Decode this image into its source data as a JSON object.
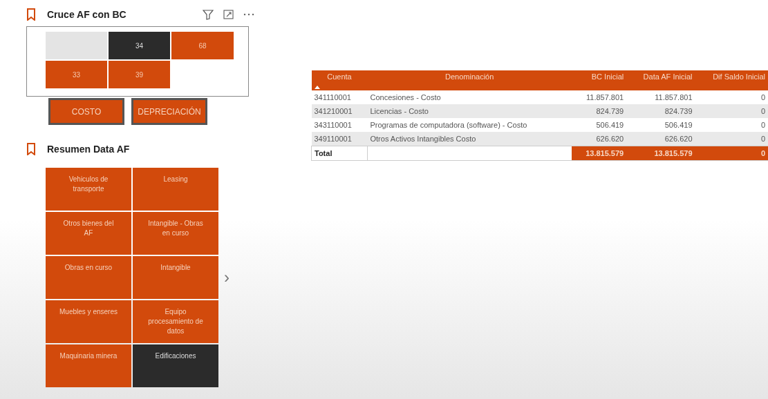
{
  "cruce": {
    "title": "Cruce AF con BC",
    "tiles": [
      {
        "kind": "blank",
        "selected": false
      },
      {
        "kind": "value",
        "label": "34",
        "selected": true
      },
      {
        "kind": "value",
        "label": "68",
        "selected": false
      },
      {
        "kind": "value",
        "label": "33",
        "selected": false
      },
      {
        "kind": "value",
        "label": "39",
        "selected": false
      }
    ],
    "buttons": [
      "COSTO",
      "DEPRECIACIÓN"
    ]
  },
  "resumen": {
    "title": "Resumen Data AF",
    "tiles": [
      {
        "label": "Vehiculos de transporte",
        "selected": false
      },
      {
        "label": "Leasing",
        "selected": false
      },
      {
        "label": "Otros bienes del AF",
        "selected": false
      },
      {
        "label": "Intangible - Obras en curso",
        "selected": false
      },
      {
        "label": "Obras en curso",
        "selected": false
      },
      {
        "label": "Intangible",
        "selected": false
      },
      {
        "label": "Muebles y enseres",
        "selected": false
      },
      {
        "label": "Equipo procesamiento de datos",
        "selected": false
      },
      {
        "label": "Maquinaria minera",
        "selected": false
      },
      {
        "label": "Edificaciones",
        "selected": true
      }
    ],
    "next": "›"
  },
  "table": {
    "columns": [
      "Cuenta",
      "Denominación",
      "BC Inicial",
      "Data AF Inicial",
      "Dif Saldo Inicial"
    ],
    "rows": [
      [
        "341110001",
        "Concesiones - Costo",
        "11.857.801",
        "11.857.801",
        "0"
      ],
      [
        "341210001",
        "Licencias - Costo",
        "824.739",
        "824.739",
        "0"
      ],
      [
        "343110001",
        "Programas de computadora (software) - Costo",
        "506.419",
        "506.419",
        "0"
      ],
      [
        "349110001",
        "Otros Activos Intangibles Costo",
        "626.620",
        "626.620",
        "0"
      ]
    ],
    "total": [
      "Total",
      "13.815.579",
      "13.815.579",
      "0"
    ]
  }
}
